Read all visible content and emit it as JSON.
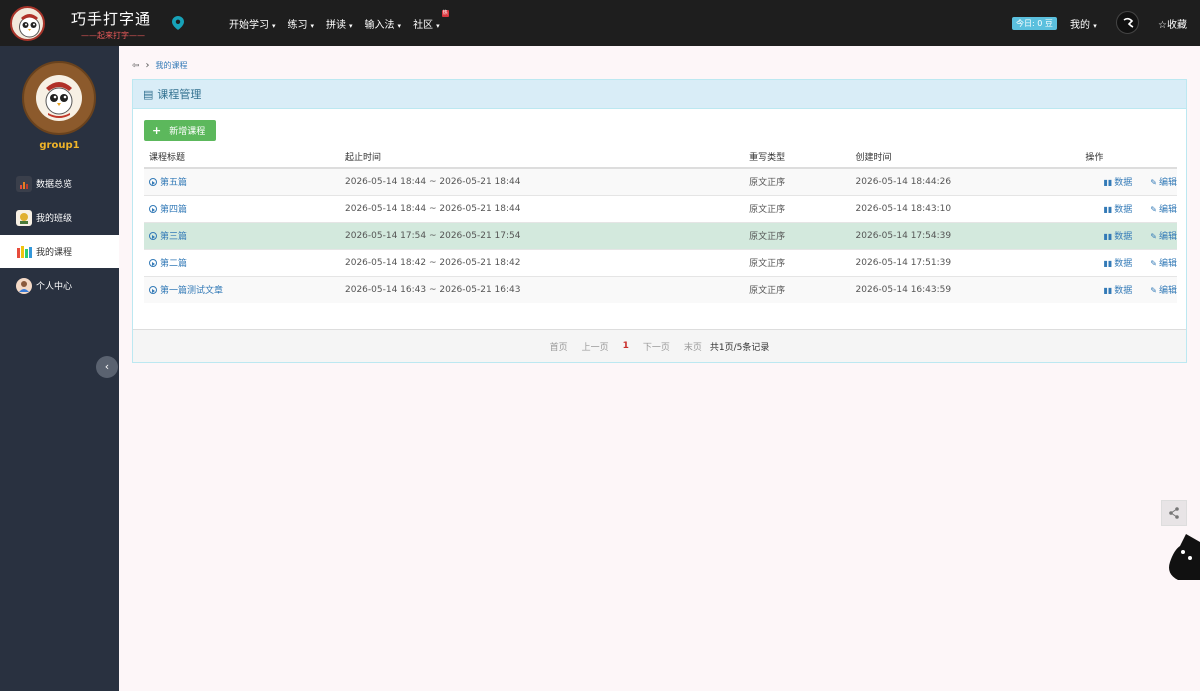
{
  "header": {
    "brand_title": "巧手打字通",
    "brand_sub": "——起来打字——",
    "nav": [
      {
        "label": "开始学习",
        "caret": "▾"
      },
      {
        "label": "练习",
        "caret": "▾"
      },
      {
        "label": "拼读",
        "caret": "▾"
      },
      {
        "label": "输入法",
        "caret": "▾"
      },
      {
        "label": "社区",
        "caret": "▾"
      }
    ],
    "hot_badge": "热",
    "today_badge": "今日: 0 豆",
    "mine_label": "我的",
    "mine_caret": "▾",
    "favorite_label": "☆收藏"
  },
  "sidebar": {
    "group_name": "group1",
    "items": [
      {
        "label": "数据总览",
        "icon": "chart-icon",
        "color": "#c0392b"
      },
      {
        "label": "我的班级",
        "icon": "class-icon",
        "color": "#e0b030"
      },
      {
        "label": "我的课程",
        "icon": "course-icon",
        "color": "#4a90d9"
      },
      {
        "label": "个人中心",
        "icon": "user-icon",
        "color": "#e8a87c"
      }
    ],
    "active_index": 2,
    "collapse_glyph": "‹"
  },
  "breadcrumb": {
    "home_glyph": "⇦",
    "sep": "›",
    "current": "我的课程"
  },
  "panel": {
    "title": "课程管理",
    "list_icon": "▤",
    "add_button": "新增课程",
    "add_plus": "+"
  },
  "table": {
    "columns": [
      "课程标题",
      "起止时间",
      "重写类型",
      "创建时间",
      "操作"
    ],
    "rows": [
      {
        "title": "第五篇",
        "period": "2026-05-14 18:44 ~ 2026-05-21 18:44",
        "type": "原文正序",
        "created": "2026-05-14 18:44:26"
      },
      {
        "title": "第四篇",
        "period": "2026-05-14 18:44 ~ 2026-05-21 18:44",
        "type": "原文正序",
        "created": "2026-05-14 18:43:10"
      },
      {
        "title": "第三篇",
        "period": "2026-05-14 17:54 ~ 2026-05-21 17:54",
        "type": "原文正序",
        "created": "2026-05-14 17:54:39"
      },
      {
        "title": "第二篇",
        "period": "2026-05-14 18:42 ~ 2026-05-21 18:42",
        "type": "原文正序",
        "created": "2026-05-14 17:51:39"
      },
      {
        "title": "第一篇测试文章",
        "period": "2026-05-14 16:43 ~ 2026-05-21 16:43",
        "type": "原文正序",
        "created": "2026-05-14 16:43:59"
      }
    ],
    "op_data": "数据",
    "op_edit": "编辑",
    "op_data_icon": "▮▮",
    "op_edit_icon": "✎"
  },
  "pager": {
    "first": "首页",
    "prev": "上一页",
    "current": "1",
    "next": "下一页",
    "last": "末页",
    "total": "共1页/5条记录"
  },
  "share_glyph": "<"
}
